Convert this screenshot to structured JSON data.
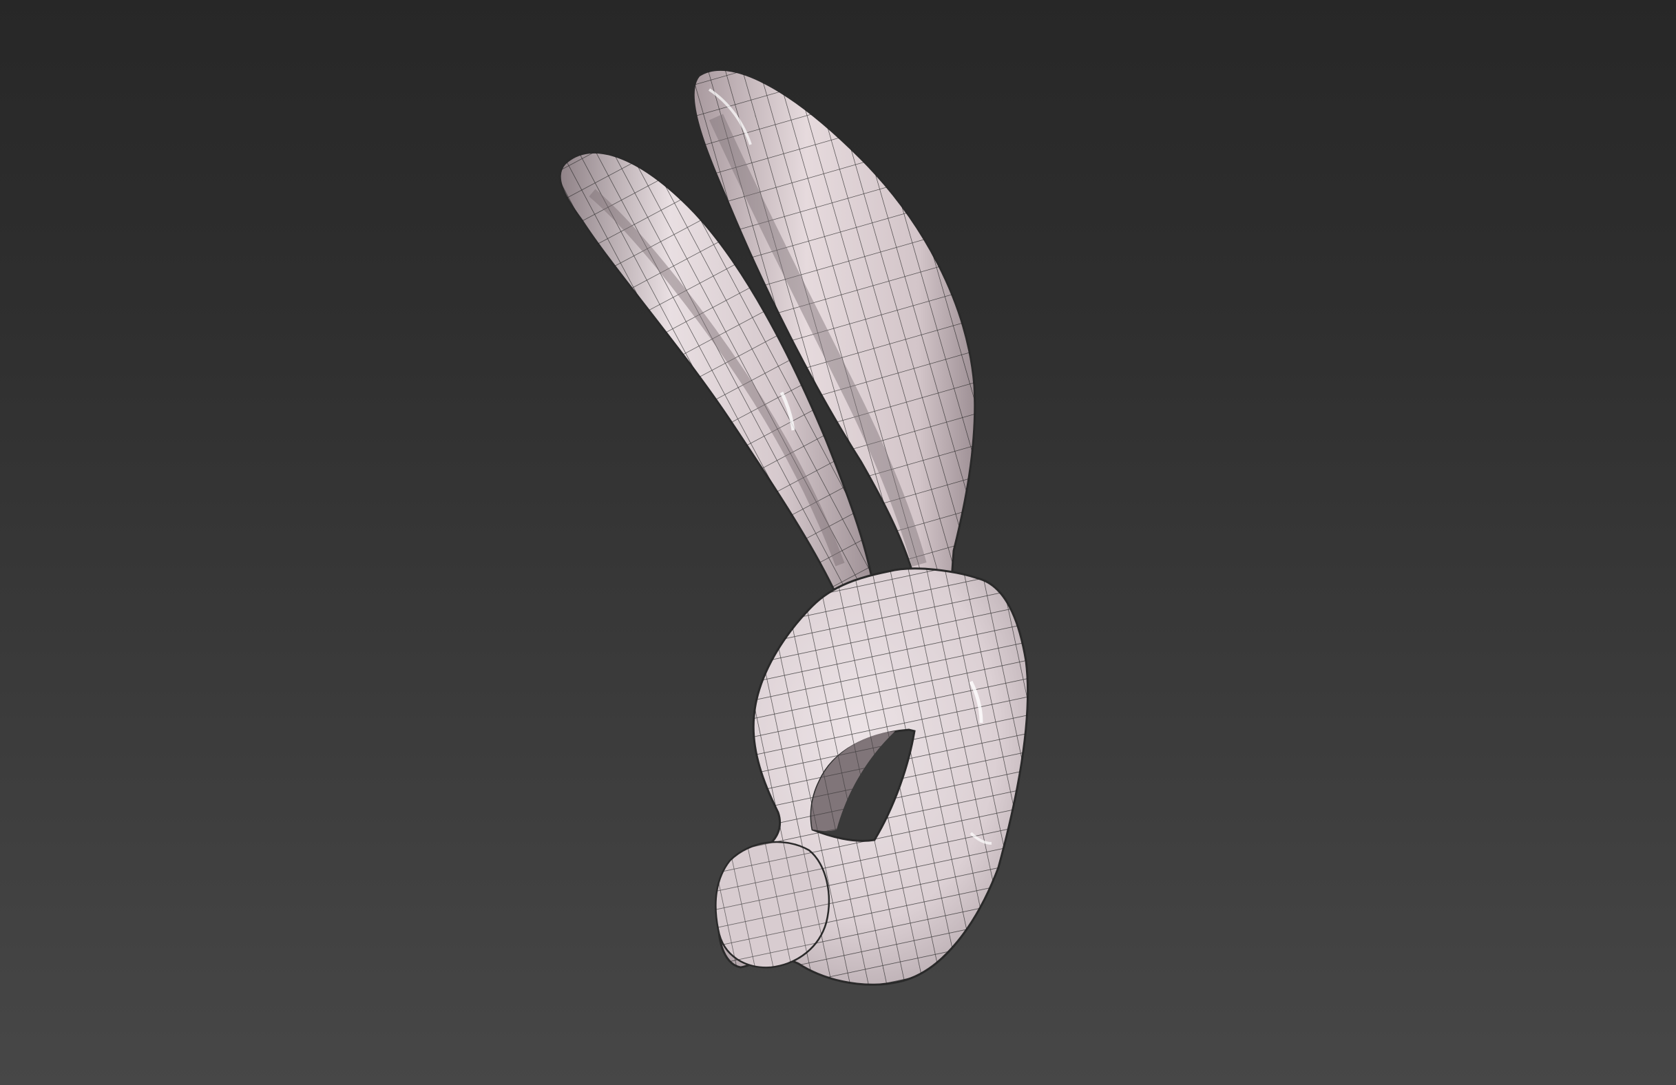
{
  "viewport": {
    "background_top": "#272727",
    "background_bottom": "#474747"
  },
  "model": {
    "subject": "rabbit-mask-wireframe",
    "surface_color": "#e4d8dc",
    "wire_color": "#1e1e1e",
    "shade_color": "#b9a9ae"
  }
}
